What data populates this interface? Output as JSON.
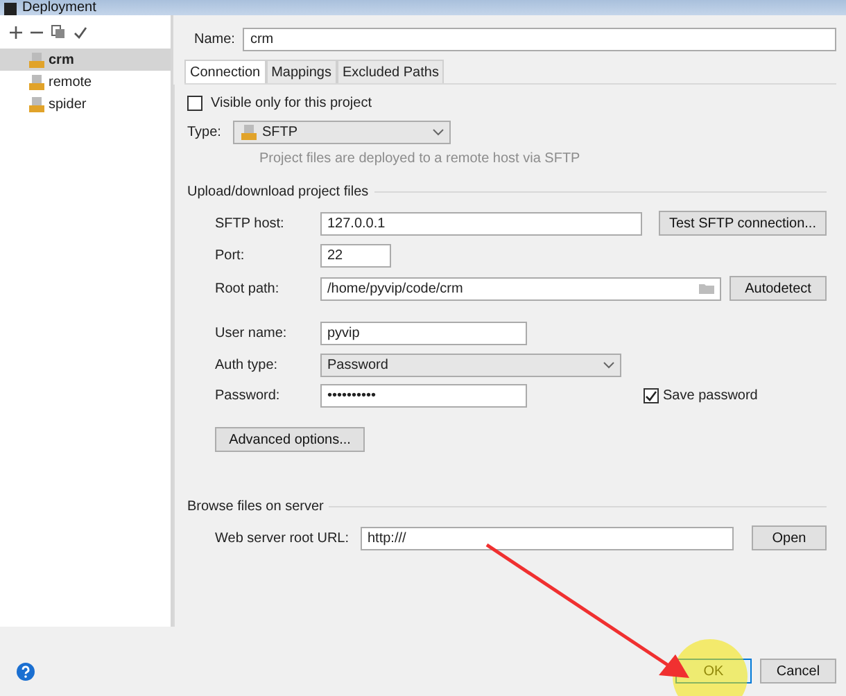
{
  "window": {
    "title": "Deployment"
  },
  "servers": [
    {
      "name": "crm",
      "selected": true
    },
    {
      "name": "remote",
      "selected": false
    },
    {
      "name": "spider",
      "selected": false
    }
  ],
  "name_field": {
    "label": "Name:",
    "value": "crm"
  },
  "tabs": [
    {
      "label": "Connection",
      "selected": true
    },
    {
      "label": "Mappings",
      "selected": false
    },
    {
      "label": "Excluded Paths",
      "selected": false
    }
  ],
  "visible_only": {
    "label": "Visible only for this project",
    "checked": false
  },
  "type": {
    "label": "Type:",
    "value": "SFTP",
    "hint": "Project files are deployed to a remote host via SFTP"
  },
  "upload": {
    "title": "Upload/download project files",
    "sftp_host": {
      "label": "SFTP host:",
      "value": "127.0.0.1",
      "button": "Test SFTP connection..."
    },
    "port": {
      "label": "Port:",
      "value": "22"
    },
    "root_path": {
      "label": "Root path:",
      "value": "/home/pyvip/code/crm",
      "button": "Autodetect"
    },
    "user_name": {
      "label": "User name:",
      "value": "pyvip"
    },
    "auth_type": {
      "label": "Auth type:",
      "value": "Password"
    },
    "password": {
      "label": "Password:",
      "value": "••••••••••"
    },
    "save_password": {
      "label": "Save password",
      "checked": true
    },
    "advanced": "Advanced options..."
  },
  "browse": {
    "title": "Browse files on server",
    "label": "Web server root URL:",
    "value": "http:///",
    "button": "Open"
  },
  "footer": {
    "buttons": [
      {
        "label": "OK",
        "focused": true
      },
      {
        "label": "Cancel",
        "focused": false
      }
    ]
  }
}
